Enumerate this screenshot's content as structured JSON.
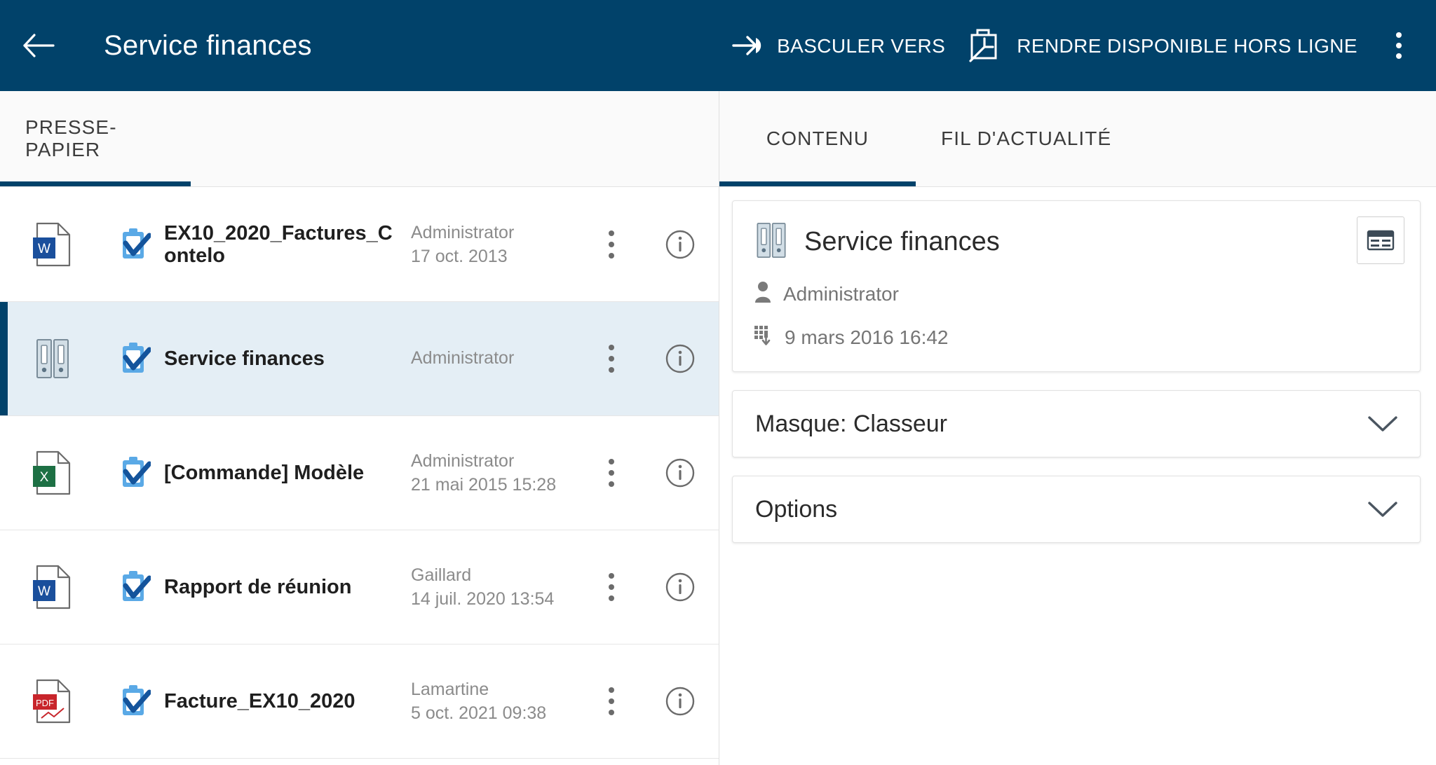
{
  "appbar": {
    "back_icon": "arrow-left-icon",
    "title": "Service finances",
    "actions": [
      {
        "id": "switch-to",
        "icon": "arrow-switch-icon",
        "label": "BASCULER VERS"
      },
      {
        "id": "make-offline",
        "icon": "briefcase-offline-icon",
        "label": "RENDRE DISPONIBLE HORS LIGNE"
      }
    ],
    "overflow_icon": "kebab-menu-icon",
    "bg_color": "#01426A"
  },
  "left_panel": {
    "tabs": [
      {
        "id": "presse-papier",
        "label": "PRESSE-PAPIER",
        "active": true
      }
    ],
    "rows": [
      {
        "file_icon": "word-document-icon",
        "status_icon": "clipboard-check-icon",
        "name": "EX10_2020_Factures_Contelo",
        "author": "Administrator",
        "date": "17 oct. 2013",
        "selected": false,
        "kebab_icon": "kebab-menu-icon",
        "info_icon": "info-circle-icon"
      },
      {
        "file_icon": "binder-folder-icon",
        "status_icon": "clipboard-check-icon",
        "name": "Service finances",
        "author": "Administrator",
        "date": "",
        "selected": true,
        "kebab_icon": "kebab-menu-icon",
        "info_icon": "info-circle-icon"
      },
      {
        "file_icon": "excel-document-icon",
        "status_icon": "clipboard-check-icon",
        "name": "[Commande]  Modèle",
        "author": "Administrator",
        "date": "21 mai 2015 15:28",
        "selected": false,
        "kebab_icon": "kebab-menu-icon",
        "info_icon": "info-circle-icon"
      },
      {
        "file_icon": "word-document-icon",
        "status_icon": "clipboard-check-icon",
        "name": "Rapport de réunion",
        "author": "Gaillard",
        "date": "14 juil. 2020 13:54",
        "selected": false,
        "kebab_icon": "kebab-menu-icon",
        "info_icon": "info-circle-icon"
      },
      {
        "file_icon": "pdf-document-icon",
        "status_icon": "clipboard-check-icon",
        "name": "Facture_EX10_2020",
        "author": "Lamartine",
        "date": "5 oct. 2021 09:38",
        "selected": false,
        "kebab_icon": "kebab-menu-icon",
        "info_icon": "info-circle-icon"
      }
    ]
  },
  "right_panel": {
    "tabs": [
      {
        "id": "contenu",
        "label": "CONTENU",
        "active": true
      },
      {
        "id": "fil-actualite",
        "label": "FIL D'ACTUALITÉ",
        "active": false
      }
    ],
    "detail_card": {
      "icon": "binder-folder-icon",
      "title": "Service finances",
      "grid_button_icon": "table-view-icon",
      "meta": [
        {
          "icon": "user-icon",
          "text": "Administrator"
        },
        {
          "icon": "calendar-date-icon",
          "text": "9 mars 2016 16:42"
        }
      ]
    },
    "accordions": [
      {
        "id": "masque",
        "label": "Masque: Classeur",
        "chevron_icon": "chevron-down-icon"
      },
      {
        "id": "options",
        "label": "Options",
        "chevron_icon": "chevron-down-icon"
      }
    ]
  }
}
